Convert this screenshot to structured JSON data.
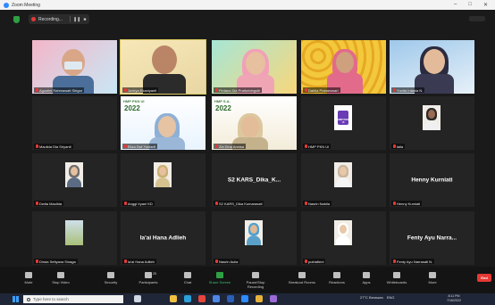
{
  "window": {
    "title": "Zoom Meeting",
    "controls": {
      "minimize": "–",
      "maximize": "□",
      "close": "✕"
    }
  },
  "meeting": {
    "recording_label": "Recording...",
    "pause_symbol": "❚❚",
    "stop_symbol": "■"
  },
  "participants": [
    {
      "id": "p1",
      "name": "Agustini Rahmawati Sirigar",
      "video": true,
      "muted": true
    },
    {
      "id": "p2",
      "name": "Jurkiya Ekaniyanti",
      "video": true,
      "muted": true,
      "speaking": true
    },
    {
      "id": "p3",
      "name": "Firdaus Dia Pratiwiningsih",
      "video": true,
      "muted": true
    },
    {
      "id": "p4",
      "name": "Dahlia Prameswari",
      "video": true,
      "muted": true
    },
    {
      "id": "p5",
      "name": "Yunita Intania N.",
      "video": true,
      "muted": true
    },
    {
      "id": "p6",
      "name": "Maulida Dia Sriyanti",
      "video": false,
      "muted": true
    },
    {
      "id": "p7",
      "name": "Eliza Dwi Yuniarti",
      "video": true,
      "muted": true
    },
    {
      "id": "p8",
      "name": "Zia Dina Annisa",
      "video": true,
      "muted": true
    },
    {
      "id": "p9",
      "name": "HMP PKN UI",
      "video": true,
      "muted": true
    },
    {
      "id": "p10",
      "name": "laila",
      "video": true,
      "muted": true
    },
    {
      "id": "p11",
      "name": "Dwita Maulida",
      "video": true,
      "muted": true
    },
    {
      "id": "p12",
      "name": "Anggi Iryani KD",
      "video": true,
      "muted": true
    },
    {
      "id": "p13",
      "name": "S2 KARS_Dika Kumarasati",
      "display": "S2 KARS_Dika_K...",
      "video": false,
      "muted": true
    },
    {
      "id": "p14",
      "name": "Nasrin Nabila",
      "video": true,
      "muted": true
    },
    {
      "id": "p15",
      "name": "Henny Kurniati",
      "display": "Henny Kurniati",
      "video": false,
      "muted": true
    },
    {
      "id": "p16",
      "name": "Dinda Setiyana Sinaga",
      "video": true,
      "muted": true
    },
    {
      "id": "p17",
      "name": "Ia'ai Hana Adlieh",
      "display": "Ia'ai Hana Adlieh",
      "video": false,
      "muted": true
    },
    {
      "id": "p18",
      "name": "Nasrin Aulia",
      "video": true,
      "muted": true
    },
    {
      "id": "p19",
      "name": "putriafieni",
      "video": true,
      "muted": true
    },
    {
      "id": "p20",
      "name": "Fenty Ayu Narrasati N.",
      "display": "Fenty Ayu Narra...",
      "video": false,
      "muted": true
    }
  ],
  "tile_decor": {
    "p7_banner": "HMP PKN UI",
    "p7_year": "2022",
    "p8_banner": "HMP S.A.",
    "p8_year": "2022",
    "p9_badge": "HMP PKN UI"
  },
  "toolbar": [
    {
      "id": "mute",
      "label": "Mute",
      "icon": "microphone-icon"
    },
    {
      "id": "video",
      "label": "Stop Video",
      "icon": "video-camera-icon"
    },
    {
      "id": "security",
      "label": "Security",
      "icon": "shield-icon"
    },
    {
      "id": "participants",
      "label": "Participants",
      "icon": "people-icon",
      "count": "25"
    },
    {
      "id": "chat",
      "label": "Chat",
      "icon": "chat-bubble-icon"
    },
    {
      "id": "share",
      "label": "Share Screen",
      "icon": "share-screen-icon",
      "accent": true
    },
    {
      "id": "record",
      "label": "Pause/Stop Recording",
      "icon": "pause-stop-icon"
    },
    {
      "id": "rooms",
      "label": "Breakout Rooms",
      "icon": "grid-icon"
    },
    {
      "id": "reactions",
      "label": "Reactions",
      "icon": "smile-icon"
    },
    {
      "id": "apps",
      "label": "Apps",
      "icon": "apps-icon"
    },
    {
      "id": "whiteboards",
      "label": "Whiteboards",
      "icon": "whiteboard-icon"
    },
    {
      "id": "more",
      "label": "More",
      "icon": "ellipsis-icon"
    }
  ],
  "end_label": "End",
  "taskbar": {
    "search_placeholder": "Type here to search",
    "weather": "27°C Berawan",
    "language": "ENG",
    "time": "8:11 PM",
    "date": "7/16/2022"
  },
  "colors": {
    "accent_green": "#2ea043",
    "record_red": "#e53935",
    "speaker_border": "#d8c75c",
    "tile_bg": "#242424"
  }
}
